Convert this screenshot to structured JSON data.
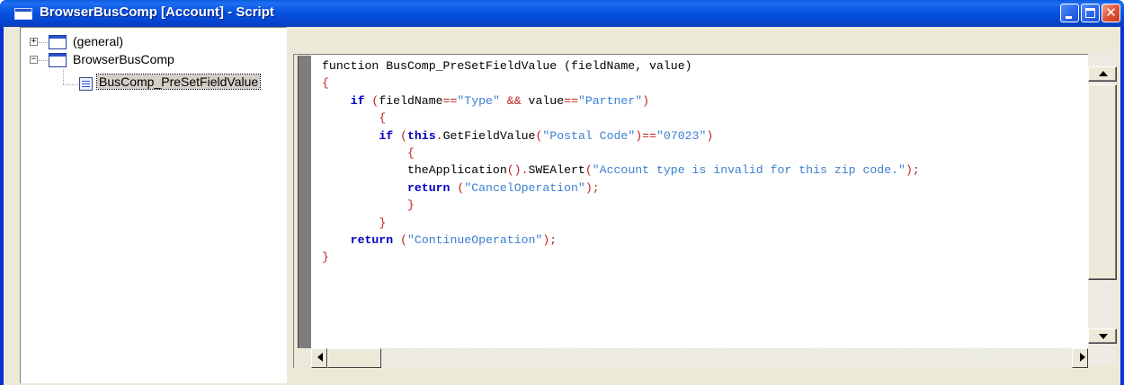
{
  "window": {
    "title": "BrowserBusComp [Account] - Script"
  },
  "tree": {
    "items": [
      {
        "label": "(general)",
        "expander": "+"
      },
      {
        "label": "BrowserBusComp",
        "expander": "−"
      },
      {
        "label": "BusComp_PreSetFieldValue",
        "selected": true
      }
    ]
  },
  "editor": {
    "lines": [
      [
        [
          "id",
          "function BusComp_PreSetFieldValue (fieldName, value)"
        ]
      ],
      [
        [
          "pun",
          "{"
        ]
      ],
      [
        [
          "id",
          "    "
        ],
        [
          "kw",
          "if"
        ],
        [
          "id",
          " "
        ],
        [
          "pun",
          "("
        ],
        [
          "id",
          "fieldName"
        ],
        [
          "pun",
          "=="
        ],
        [
          "str",
          "\"Type\""
        ],
        [
          "id",
          " "
        ],
        [
          "pun",
          "&&"
        ],
        [
          "id",
          " value"
        ],
        [
          "pun",
          "=="
        ],
        [
          "str",
          "\"Partner\""
        ],
        [
          "pun",
          ")"
        ]
      ],
      [
        [
          "id",
          "        "
        ],
        [
          "pun",
          "{"
        ]
      ],
      [
        [
          "id",
          "        "
        ],
        [
          "kw",
          "if"
        ],
        [
          "id",
          " "
        ],
        [
          "pun",
          "("
        ],
        [
          "kw",
          "this"
        ],
        [
          "pun",
          "."
        ],
        [
          "id",
          "GetFieldValue"
        ],
        [
          "pun",
          "("
        ],
        [
          "str",
          "\"Postal Code\""
        ],
        [
          "pun",
          ")=="
        ],
        [
          "str",
          "\"07023\""
        ],
        [
          "pun",
          ")"
        ]
      ],
      [
        [
          "id",
          "            "
        ],
        [
          "pun",
          "{"
        ]
      ],
      [
        [
          "id",
          "            theApplication"
        ],
        [
          "pun",
          "()."
        ],
        [
          "id",
          "SWEAlert"
        ],
        [
          "pun",
          "("
        ],
        [
          "str",
          "\"Account type is invalid for this zip code.\""
        ],
        [
          "pun",
          ");"
        ]
      ],
      [
        [
          "id",
          "            "
        ],
        [
          "kw",
          "return"
        ],
        [
          "id",
          " "
        ],
        [
          "pun",
          "("
        ],
        [
          "str",
          "\"CancelOperation\""
        ],
        [
          "pun",
          ");"
        ]
      ],
      [
        [
          "id",
          "            "
        ],
        [
          "pun",
          "}"
        ]
      ],
      [
        [
          "id",
          "        "
        ],
        [
          "pun",
          "}"
        ]
      ],
      [
        [
          "id",
          "    "
        ],
        [
          "kw",
          "return"
        ],
        [
          "id",
          " "
        ],
        [
          "pun",
          "("
        ],
        [
          "str",
          "\"ContinueOperation\""
        ],
        [
          "pun",
          ");"
        ]
      ],
      [
        [
          "pun",
          "}"
        ]
      ]
    ]
  },
  "colors": {
    "titlebar": "#0546d2",
    "keyword": "#0000c0",
    "string": "#3b7fd1",
    "punctuation": "#c02020",
    "panel": "#ece9d8"
  },
  "icons": {
    "app": "window-icon",
    "minimize": "minimize-icon",
    "maximize": "maximize-icon",
    "close": "close-icon",
    "folder": "object-icon",
    "method": "method-icon"
  }
}
